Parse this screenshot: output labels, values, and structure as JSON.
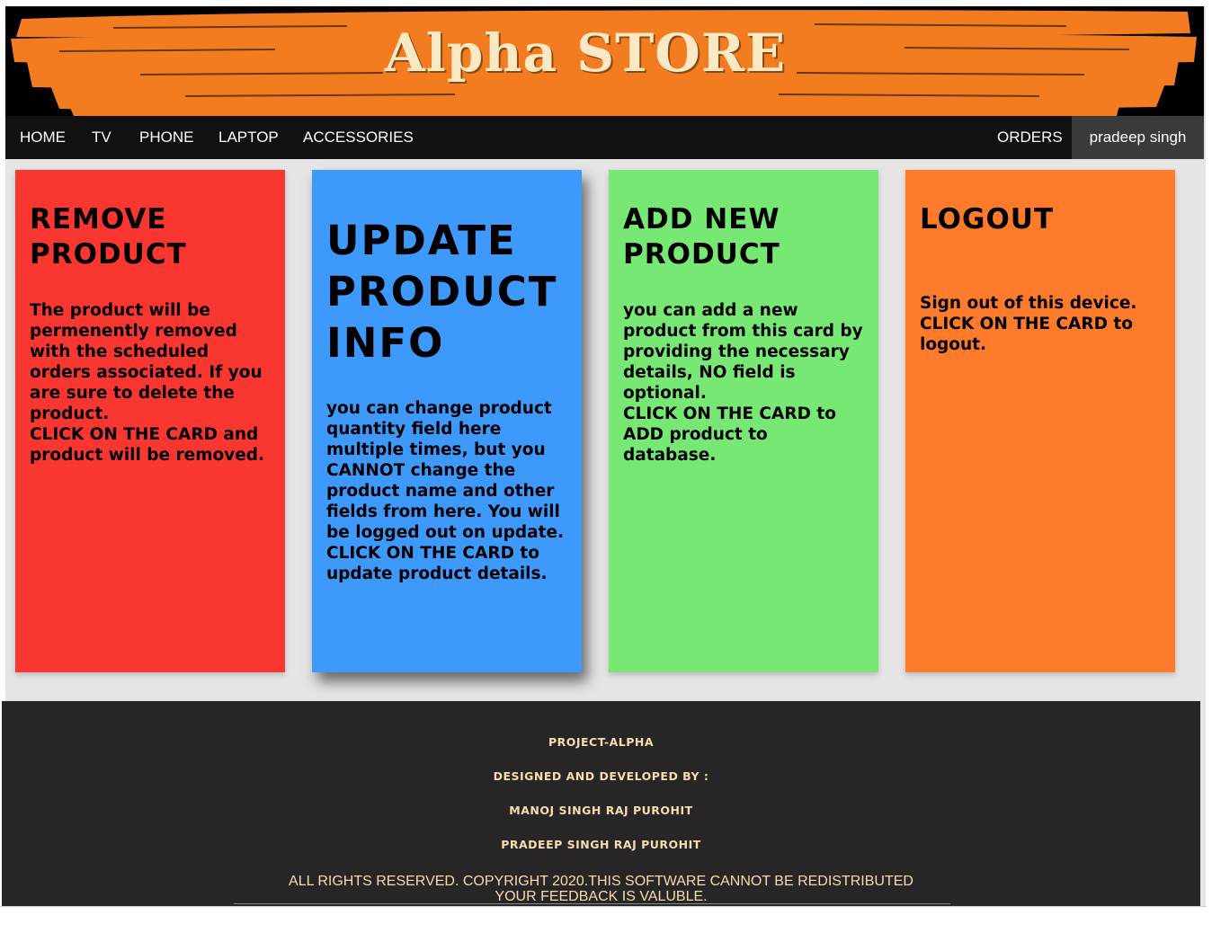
{
  "brand": {
    "title": "Alpha STORE",
    "colors": {
      "banner_bg": "#000000",
      "brush": "#f47c20",
      "title": "#fbe9c6"
    }
  },
  "nav": {
    "left": [
      "HOME",
      "TV",
      "PHONE",
      "LAPTOP",
      "ACCESSORIES"
    ],
    "orders": "ORDERS",
    "user": "pradeep singh"
  },
  "cards": {
    "remove": {
      "title_1": "REMOVE",
      "title_2": "PRODUCT",
      "body": "The product will be permenently removed with the scheduled orders associated. If you are sure to delete the product.",
      "cta": "CLICK ON THE CARD and product will be removed.",
      "color": "#f93630"
    },
    "update": {
      "title_1": "UPDATE",
      "title_2": "PRODUCT",
      "title_3": "INFO",
      "body": "you can change product quantity field here multiple times, but you CANNOT change the product name and other fields from here. You will be logged out on update.",
      "cta": "CLICK ON THE CARD to update product details.",
      "color": "#3d9afc"
    },
    "add": {
      "title_1": "ADD NEW",
      "title_2": "PRODUCT",
      "body": "you can add a new product from this card by providing the necessary details, NO field is optional.",
      "cta": "CLICK ON THE CARD to ADD product to database.",
      "color": "#78e875"
    },
    "logout": {
      "title_1": "LOGOUT",
      "body": "Sign out of this device.",
      "cta": "CLICK ON THE CARD to logout.",
      "color": "#fd7b2b"
    }
  },
  "footer": {
    "project": "PROJECT-ALPHA",
    "designed_by": "DESIGNED AND DEVELOPED BY :",
    "author_1": "MANOJ SINGH RAJ PUROHIT",
    "author_2": "PRADEEP SINGH RAJ PUROHIT",
    "copyright": "ALL RIGHTS RESERVED. COPYRIGHT 2020.THIS SOFTWARE CANNOT BE REDISTRIBUTED",
    "feedback": "YOUR FEEDBACK IS VALUBLE."
  }
}
